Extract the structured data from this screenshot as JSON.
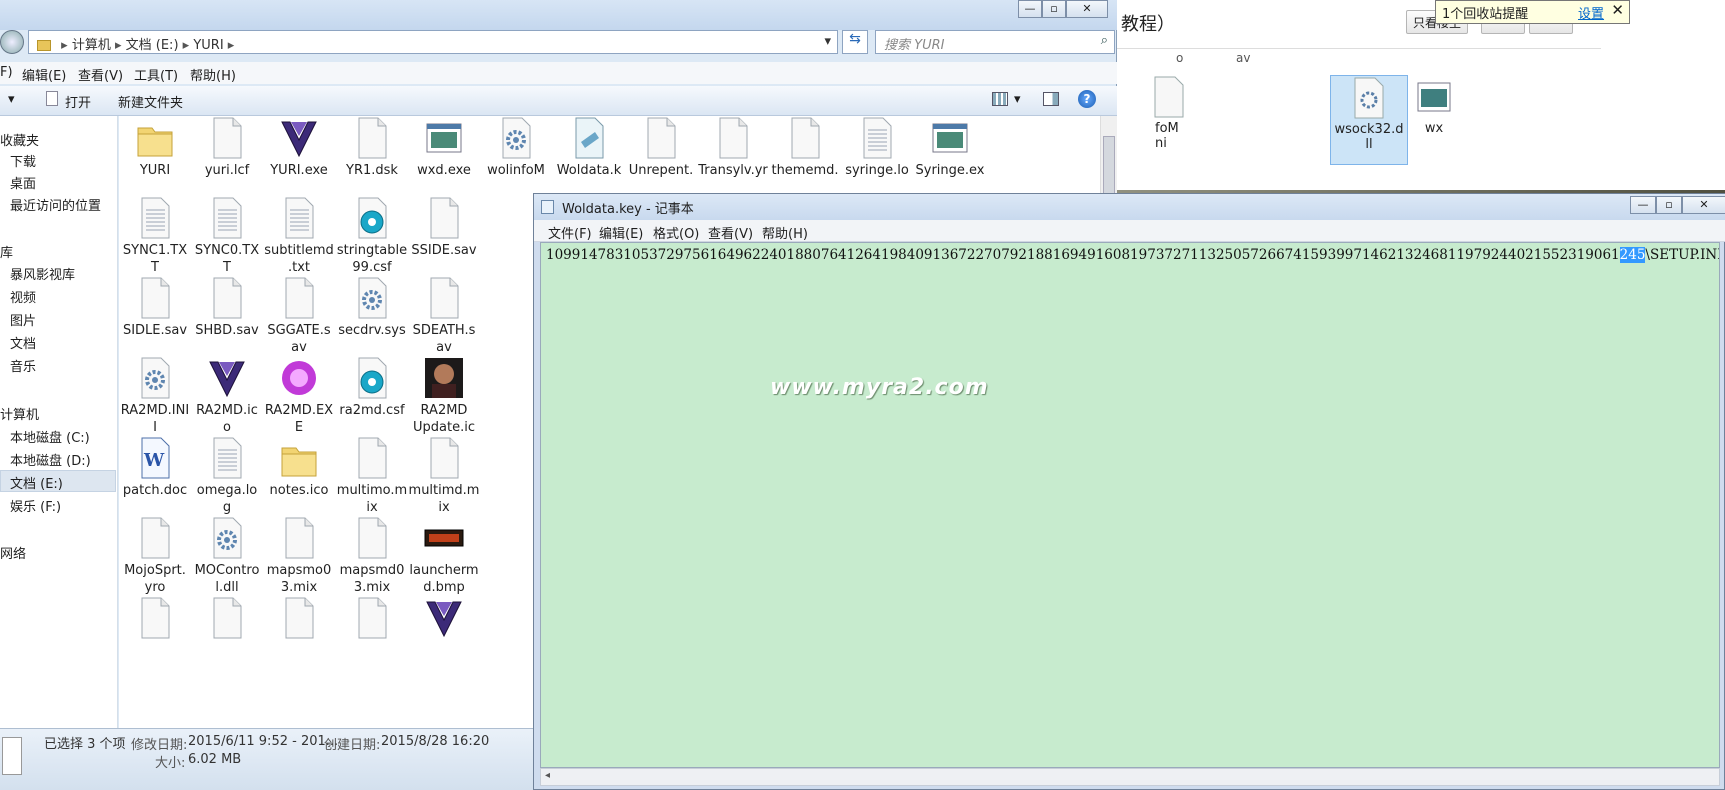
{
  "background_window": {
    "title": "教程）",
    "buttons": [
      "只看楼主",
      "",
      ""
    ],
    "files": [
      {
        "name": "foM\nni",
        "icon": "file-icon",
        "selected": false
      },
      {
        "name": "wsock32.d\nll",
        "icon": "gear-file-icon",
        "selected": true
      },
      {
        "name": "wx",
        "icon": "exe-icon",
        "selected": false
      }
    ],
    "column_label": "av",
    "column_label_left": "o"
  },
  "notification": {
    "text": "1个回收站提醒",
    "link": "设置",
    "close": "✕"
  },
  "explorer": {
    "breadcrumb": [
      "计算机",
      "文档 (E:)",
      "YURI"
    ],
    "search_placeholder": "搜索 YURI",
    "menu": [
      "F)",
      "编辑(E)",
      "查看(V)",
      "工具(T)",
      "帮助(H)"
    ],
    "toolbar": {
      "open": "打开",
      "new_folder": "新建文件夹"
    },
    "nav": {
      "favorites": "收藏夹",
      "fav_items": [
        "下载",
        "桌面",
        "最近访问的位置"
      ],
      "libraries": "库",
      "lib_items": [
        "暴风影视库",
        "视频",
        "图片",
        "文档",
        "音乐"
      ],
      "computer": "计算机",
      "drives": [
        "本地磁盘 (C:)",
        "本地磁盘 (D:)",
        "文档 (E:)",
        "娱乐 (F:)"
      ],
      "network": "网络"
    },
    "files": [
      {
        "name": "YURI",
        "icon": "folder-icon"
      },
      {
        "name": "yuri.lcf",
        "icon": "file-icon"
      },
      {
        "name": "YURI.exe",
        "icon": "yuri-logo-icon"
      },
      {
        "name": "YR1.dsk",
        "icon": "file-icon"
      },
      {
        "name": "wxd.exe",
        "icon": "exe-icon"
      },
      {
        "name": "wolinfoM",
        "icon": "gear-file-icon"
      },
      {
        "name": "Woldata.k",
        "icon": "key-file-icon"
      },
      {
        "name": "Unrepent.",
        "icon": "file-icon"
      },
      {
        "name": "Transylv.yr",
        "icon": "file-icon"
      },
      {
        "name": "thememd.",
        "icon": "file-icon"
      },
      {
        "name": "syringe.lo",
        "icon": "text-file-icon"
      },
      {
        "name": "Syringe.ex",
        "icon": "exe-icon"
      },
      {
        "name": "SYNC1.TX\nT",
        "icon": "text-file-icon"
      },
      {
        "name": "SYNC0.TX\nT",
        "icon": "text-file-icon"
      },
      {
        "name": "subtitlemd\n.txt",
        "icon": "text-file-icon"
      },
      {
        "name": "stringtable\n99.csf",
        "icon": "media-file-icon"
      },
      {
        "name": "SSIDE.sav",
        "icon": "file-icon"
      },
      {
        "name": "SIDLE.sav",
        "icon": "file-icon"
      },
      {
        "name": "SHBD.sav",
        "icon": "file-icon"
      },
      {
        "name": "SGGATE.s\nav",
        "icon": "file-icon"
      },
      {
        "name": "secdrv.sys",
        "icon": "gear-file-icon"
      },
      {
        "name": "SDEATH.s\nav",
        "icon": "file-icon"
      },
      {
        "name": "RA2MD.INI\nI",
        "icon": "gear-file-icon"
      },
      {
        "name": "RA2MD.ic\no",
        "icon": "yuri-logo-icon"
      },
      {
        "name": "RA2MD.EX\nE",
        "icon": "purple-orb-icon"
      },
      {
        "name": "ra2md.csf",
        "icon": "media-file-icon"
      },
      {
        "name": "RA2MD\nUpdate.ic\no",
        "icon": "portrait-icon"
      },
      {
        "name": "patch.doc",
        "icon": "word-doc-icon"
      },
      {
        "name": "omega.lo\ng",
        "icon": "text-file-icon"
      },
      {
        "name": "notes.ico",
        "icon": "folder-icon"
      },
      {
        "name": "multimo.m\nix",
        "icon": "file-icon"
      },
      {
        "name": "multimd.m\nix",
        "icon": "file-icon"
      },
      {
        "name": "MojoSprt.\nyro",
        "icon": "file-icon"
      },
      {
        "name": "MOContro\nl.dll",
        "icon": "gear-file-icon"
      },
      {
        "name": "mapsmo0\n3.mix",
        "icon": "file-icon"
      },
      {
        "name": "mapsmd0\n3.mix",
        "icon": "file-icon"
      },
      {
        "name": "launcherm\nd.bmp",
        "icon": "bitmap-icon"
      },
      {
        "name": "",
        "icon": "file-icon"
      },
      {
        "name": "",
        "icon": "file-icon"
      },
      {
        "name": "",
        "icon": "file-icon"
      },
      {
        "name": "",
        "icon": "file-icon"
      },
      {
        "name": "",
        "icon": "yuri-logo-icon"
      }
    ],
    "status": {
      "selected": "已选择 3 个项",
      "modified_label": "修改日期:",
      "modified": "2015/6/11 9:52 - 201...",
      "created_label": "创建日期:",
      "created": "2015/8/28 16:20",
      "size_label": "大小:",
      "size": "6.02 MB"
    }
  },
  "notepad": {
    "title": "Woldata.key - 记事本",
    "menu": [
      "文件(F)",
      "编辑(E)",
      "格式(O)",
      "查看(V)",
      "帮助(H)"
    ],
    "text_before": "10991478310537297561649622401880764126419840913672270792188169491608197372711325057266741593997146213246811979244021552319061",
    "text_highlight": "245",
    "text_after": "\\SETUP.INI",
    "watermark": "www.myra2.com"
  },
  "colors": {
    "notepad_bg": "#c7ebce",
    "selection": "#3399ff"
  }
}
